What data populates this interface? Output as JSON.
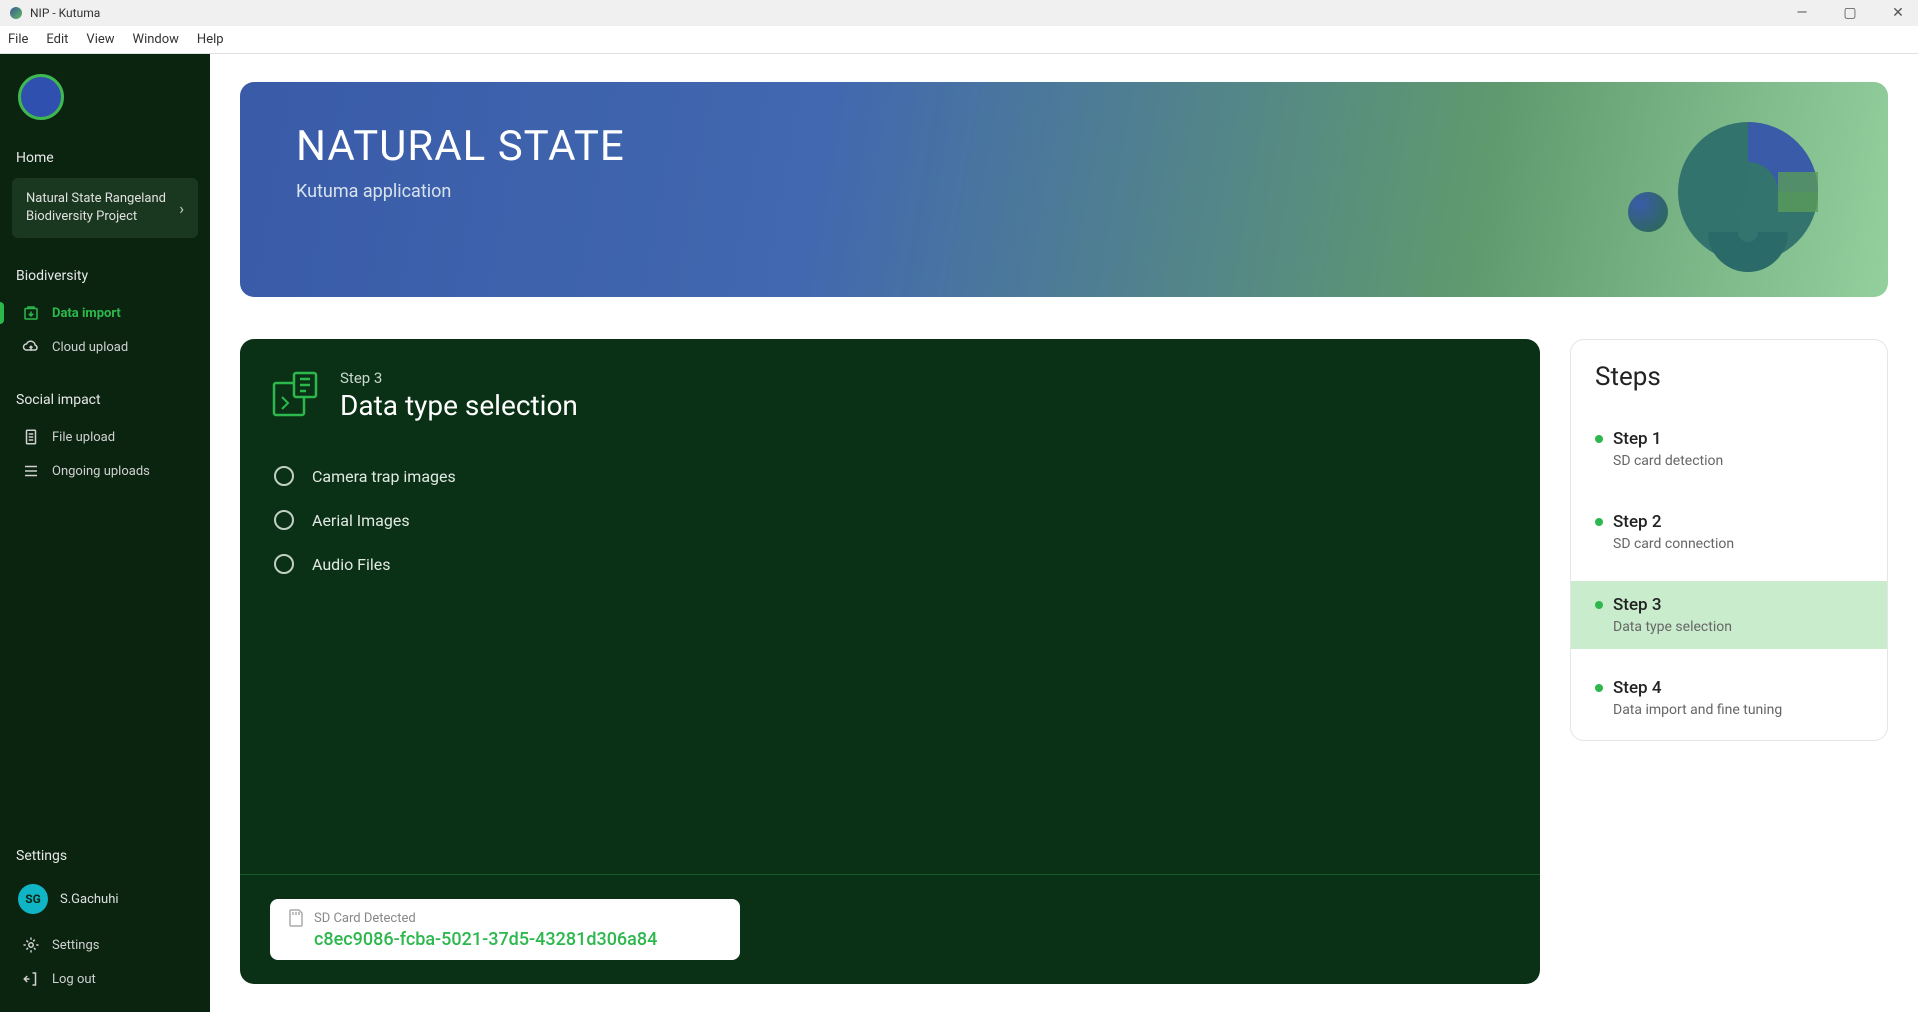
{
  "window": {
    "title": "NIP - Kutuma"
  },
  "menubar": [
    "File",
    "Edit",
    "View",
    "Window",
    "Help"
  ],
  "sidebar": {
    "home_label": "Home",
    "project_name": "Natural State Rangeland Biodiversity Project",
    "sections": [
      {
        "title": "Biodiversity",
        "items": [
          {
            "label": "Data import",
            "icon": "import-icon",
            "active": true
          },
          {
            "label": "Cloud upload",
            "icon": "cloud-icon",
            "active": false
          }
        ]
      },
      {
        "title": "Social impact",
        "items": [
          {
            "label": "File upload",
            "icon": "file-icon",
            "active": false
          },
          {
            "label": "Ongoing uploads",
            "icon": "list-icon",
            "active": false
          }
        ]
      }
    ],
    "settings_label": "Settings",
    "user": {
      "initials": "SG",
      "name": "S.Gachuhi"
    },
    "footer_items": [
      {
        "label": "Settings",
        "icon": "gear-icon"
      },
      {
        "label": "Log out",
        "icon": "logout-icon"
      }
    ]
  },
  "banner": {
    "title": "NATURAL STATE",
    "subtitle": "Kutuma application"
  },
  "card": {
    "step_label": "Step 3",
    "step_title": "Data type selection",
    "options": [
      "Camera trap images",
      "Aerial Images",
      "Audio Files"
    ],
    "sd_detected_label": "SD Card Detected",
    "sd_uuid": "c8ec9086-fcba-5021-37d5-43281d306a84"
  },
  "steps_panel": {
    "title": "Steps",
    "items": [
      {
        "name": "Step 1",
        "desc": "SD card detection",
        "active": false
      },
      {
        "name": "Step 2",
        "desc": "SD card connection",
        "active": false
      },
      {
        "name": "Step 3",
        "desc": "Data type selection",
        "active": true
      },
      {
        "name": "Step 4",
        "desc": "Data import and fine tuning",
        "active": false
      }
    ]
  }
}
